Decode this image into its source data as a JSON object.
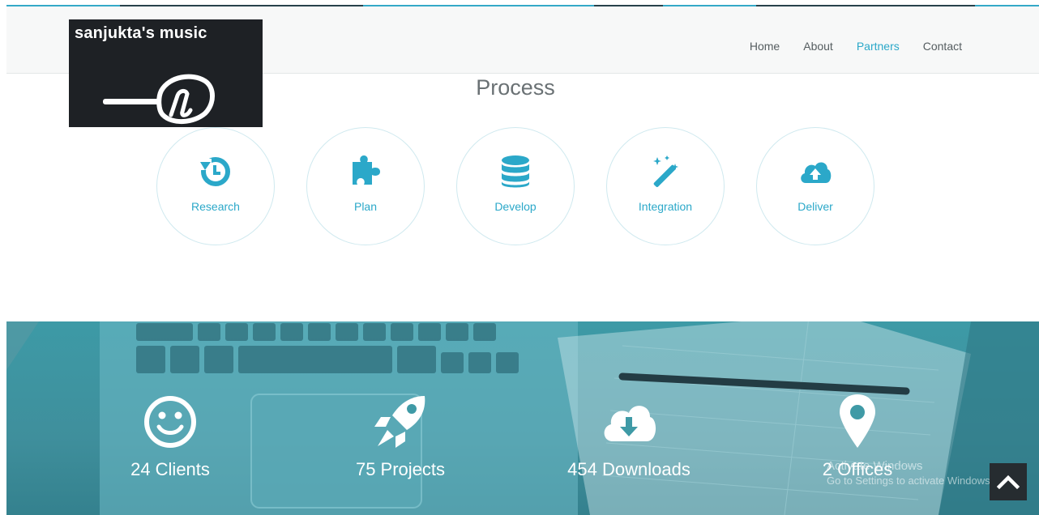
{
  "site": {
    "logo_text": "sanjukta's music",
    "nav": [
      {
        "label": "Home",
        "active": false
      },
      {
        "label": "About",
        "active": false
      },
      {
        "label": "Partners",
        "active": true
      },
      {
        "label": "Contact",
        "active": false
      }
    ]
  },
  "process": {
    "title": "Process",
    "steps": [
      {
        "label": "Research",
        "icon": "history-icon"
      },
      {
        "label": "Plan",
        "icon": "puzzle-icon"
      },
      {
        "label": "Develop",
        "icon": "database-icon"
      },
      {
        "label": "Integration",
        "icon": "magic-wand-icon"
      },
      {
        "label": "Deliver",
        "icon": "cloud-upload-icon"
      }
    ]
  },
  "stats": [
    {
      "label": "24 Clients",
      "icon": "smile-icon"
    },
    {
      "label": "75 Projects",
      "icon": "rocket-icon"
    },
    {
      "label": "454 Downloads",
      "icon": "cloud-download-icon"
    },
    {
      "label": "2 Offices",
      "icon": "map-marker-icon"
    }
  ],
  "os_watermark": {
    "line1": "Activate Windows",
    "line2": "Go to Settings to activate Windows."
  },
  "colors": {
    "accent": "#2ba8c9",
    "band": "#3d9aa6",
    "logo_bg": "#1e2125"
  }
}
